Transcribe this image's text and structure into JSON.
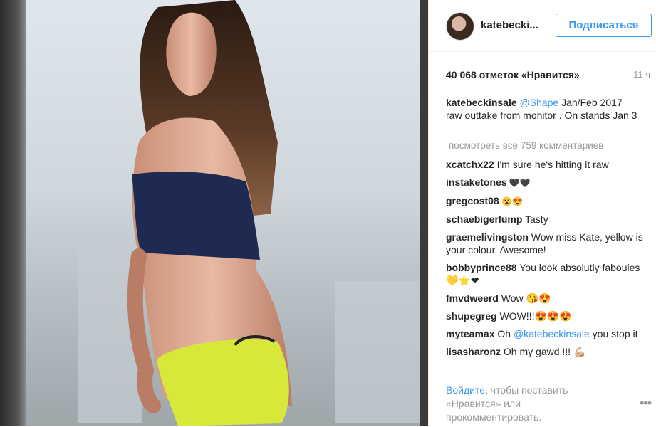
{
  "header": {
    "username": "katebecki...",
    "follow_label": "Подписаться"
  },
  "post": {
    "likes": "40 068 отметок «Нравится»",
    "time": "11 ч",
    "caption": {
      "author": "katebeckinsale",
      "mention": "@Shape",
      "text": " Jan/Feb 2017 raw outtake from monitor . On stands Jan 3"
    },
    "view_all": "посмотреть все 759 комментариев"
  },
  "comments": [
    {
      "user": "xcatchx22",
      "text": " I'm sure he's hitting it raw"
    },
    {
      "user": "instaketones",
      "text": " 🖤🖤"
    },
    {
      "user": "gregcost08",
      "text": " 😮😍"
    },
    {
      "user": "schaebigerlump",
      "text": " Tasty"
    },
    {
      "user": "graemelivingston",
      "text": " Wow miss Kate, yellow is your colour. Awesome!"
    },
    {
      "user": "bobbyprince88",
      "text": " You look absolutly faboules 💛⭐❤"
    },
    {
      "user": "fmvdweerd",
      "text": " Wow 😘😍"
    },
    {
      "user": "shupegreg",
      "text": " WOW!!!😍😍😍"
    },
    {
      "user": "myteamax",
      "text": " Oh ",
      "mention": "@katebeckinsale",
      "text2": " you stop it"
    },
    {
      "user": "lisasharonz",
      "text": " Oh my gawd !!! 💪🏼"
    }
  ],
  "login": {
    "link": "Войдите",
    "text": ", чтобы поставить «Нравится» или прокомментировать.",
    "more": "•••"
  },
  "icons": [
    "avatar",
    "more-options-icon"
  ],
  "colors": {
    "accent": "#3897f0",
    "muted": "#999999",
    "text": "#262626"
  }
}
